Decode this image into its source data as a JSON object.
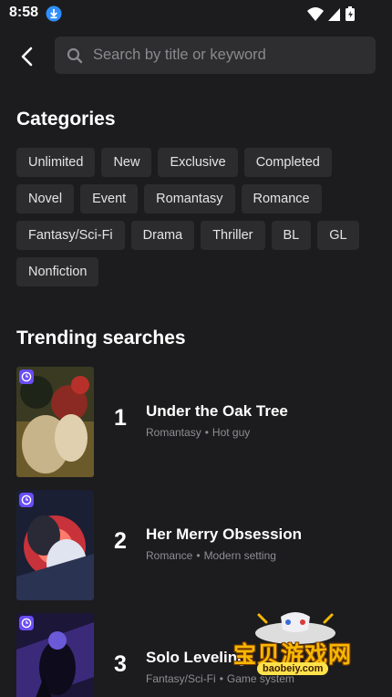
{
  "status_bar": {
    "time": "8:58"
  },
  "search": {
    "placeholder": "Search by title or keyword",
    "value": ""
  },
  "categories": {
    "title": "Categories",
    "items": [
      "Unlimited",
      "New",
      "Exclusive",
      "Completed",
      "Novel",
      "Event",
      "Romantasy",
      "Romance",
      "Fantasy/Sci-Fi",
      "Drama",
      "Thriller",
      "BL",
      "GL",
      "Nonfiction"
    ]
  },
  "trending": {
    "title": "Trending searches",
    "items": [
      {
        "rank": "1",
        "title": "Under the Oak Tree",
        "genre": "Romantasy",
        "tag": "Hot guy"
      },
      {
        "rank": "2",
        "title": "Her Merry Obsession",
        "genre": "Romance",
        "tag": "Modern setting"
      },
      {
        "rank": "3",
        "title": "Solo Leveling",
        "genre": "Fantasy/Sci-Fi",
        "tag": "Game system"
      }
    ]
  },
  "watermark": {
    "text": "宝贝游戏网",
    "url": "baobeiy.com"
  },
  "colors": {
    "background": "#1c1c1e",
    "chip": "#2c2c2e",
    "search_box": "#2e2e30",
    "badge": "#6a4df5",
    "muted_text": "#8e8e93"
  }
}
